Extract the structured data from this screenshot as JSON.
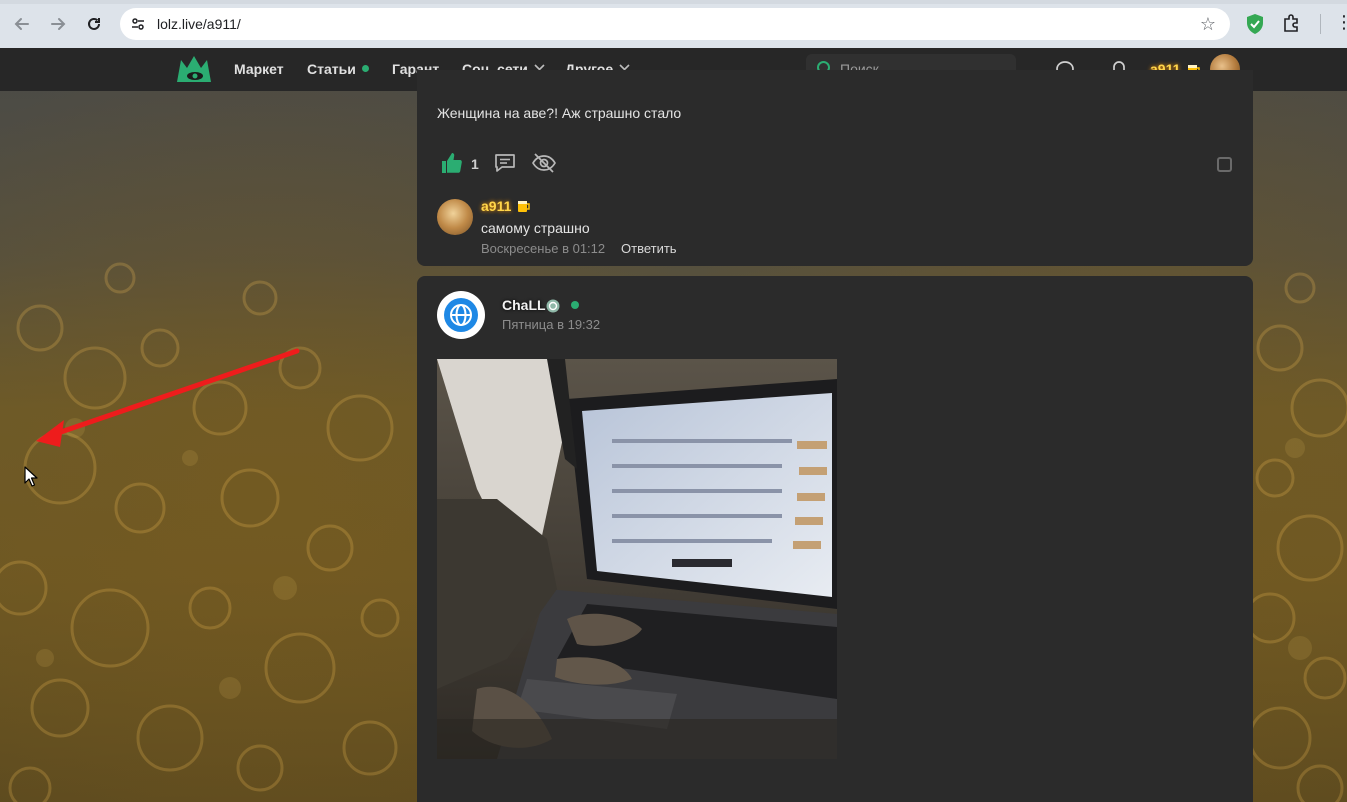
{
  "browser": {
    "url": "lolz.live/a911/",
    "icons": {
      "back": "back-arrow-icon",
      "forward": "forward-arrow-icon",
      "reload": "reload-icon",
      "site_info": "tune-icon",
      "bookmark": "star-icon",
      "extension_shield": "shield-check-icon",
      "extensions": "puzzle-icon",
      "menu": "kebab-menu-icon"
    }
  },
  "header": {
    "nav": [
      {
        "label": "Маркет"
      },
      {
        "label": "Статьи"
      },
      {
        "label": "Гарант"
      },
      {
        "label": "Соц. сети"
      },
      {
        "label": "Другое"
      }
    ],
    "search_placeholder": "Поиск...",
    "username": "a911",
    "colors": {
      "accent": "#2bad72",
      "username": "#ffd54a",
      "bar": "#272727"
    }
  },
  "post1": {
    "text": "Женщина на аве?! Аж страшно стало",
    "likes": "1",
    "reply": {
      "author": "a911",
      "text": "самому страшно",
      "time": "Воскресенье в 01:12",
      "action": "Ответить"
    }
  },
  "post2": {
    "author": "ChaLL",
    "time": "Пятница в 19:32",
    "image_description_icon": "laptop-photo"
  }
}
